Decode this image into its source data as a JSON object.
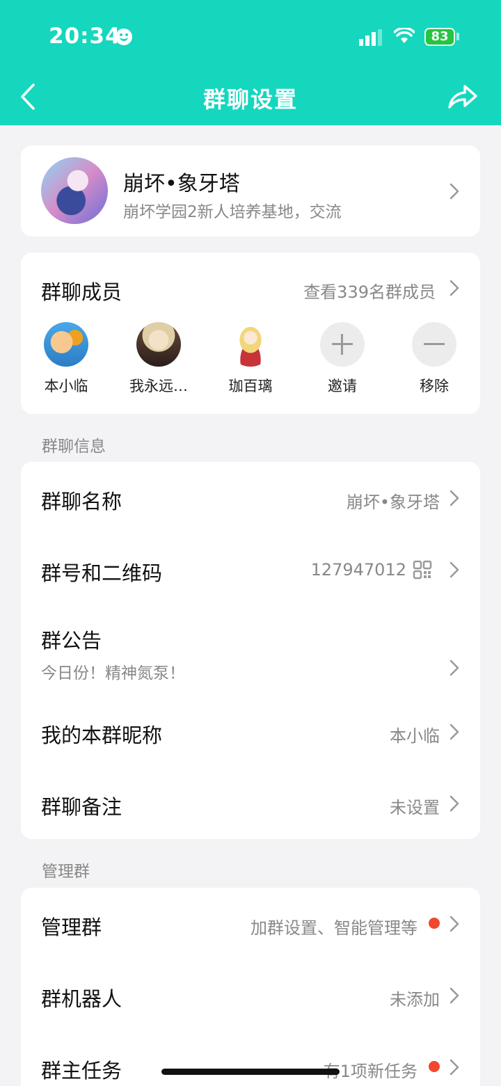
{
  "status_bar": {
    "time": "20:34",
    "battery": "83"
  },
  "header": {
    "title": "群聊设置",
    "back_icon": "chevron-left-icon",
    "share_icon": "share-icon"
  },
  "group": {
    "name": "崩坏•象牙塔",
    "description": "崩坏学园2新人培养基地，交流"
  },
  "members": {
    "title": "群聊成员",
    "count_text": "查看339名群成员",
    "list": [
      {
        "name": "本小临"
      },
      {
        "name": "我永远…"
      },
      {
        "name": "珈百璃"
      }
    ],
    "invite_label": "邀请",
    "remove_label": "移除"
  },
  "info_section": {
    "label": "群聊信息",
    "group_name_label": "群聊名称",
    "group_name_value": "崩坏•象牙塔",
    "group_id_label": "群号和二维码",
    "group_id_value": "127947012",
    "announcement_label": "群公告",
    "announcement_value": "今日份！精神氮泵！",
    "nickname_label": "我的本群昵称",
    "nickname_value": "本小临",
    "remark_label": "群聊备注",
    "remark_value": "未设置"
  },
  "manage_section": {
    "label": "管理群",
    "manage_label": "管理群",
    "manage_value": "加群设置、智能管理等",
    "robot_label": "群机器人",
    "robot_value": "未添加",
    "task_label": "群主任务",
    "task_value": "有1项新任务"
  },
  "colors": {
    "accent": "#15d7be",
    "badge": "#f2462e",
    "battery": "#24c541"
  }
}
